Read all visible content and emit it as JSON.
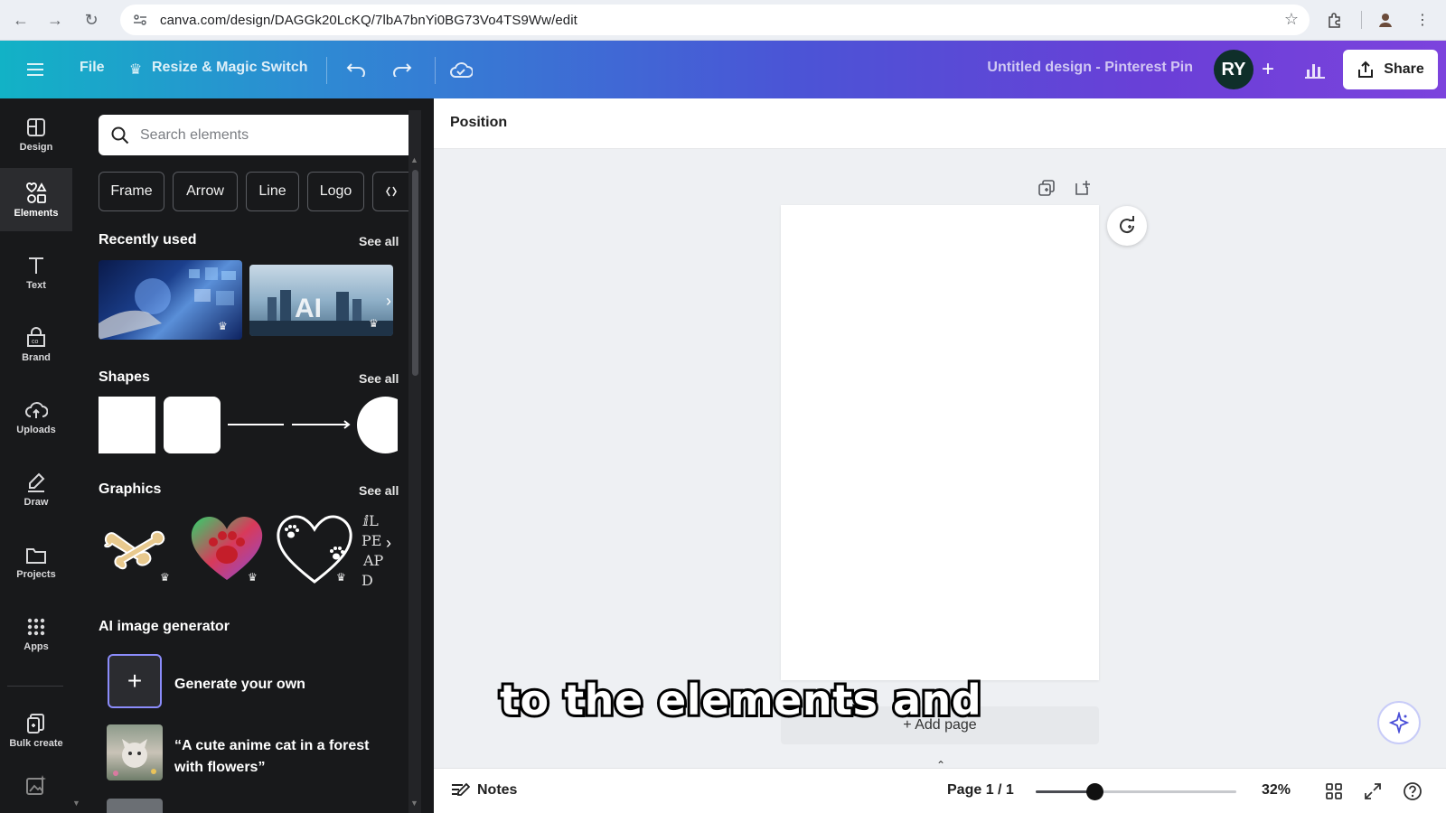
{
  "browser": {
    "url": "canva.com/design/DAGGk20LcKQ/7lbA7bnYi0BG73Vo4TS9Ww/edit"
  },
  "topbar": {
    "file_label": "File",
    "resize_label": "Resize & Magic Switch",
    "doc_title": "Untitled design - Pinterest Pin",
    "avatar_initials": "RY",
    "share_label": "Share",
    "gradient_start": "#12b2c6",
    "gradient_end": "#7c43dd"
  },
  "rail": {
    "items": [
      {
        "label": "Design",
        "icon": "design-icon"
      },
      {
        "label": "Elements",
        "icon": "elements-icon"
      },
      {
        "label": "Text",
        "icon": "text-icon"
      },
      {
        "label": "Brand",
        "icon": "brand-icon"
      },
      {
        "label": "Uploads",
        "icon": "uploads-icon"
      },
      {
        "label": "Draw",
        "icon": "draw-icon"
      },
      {
        "label": "Projects",
        "icon": "projects-icon"
      },
      {
        "label": "Apps",
        "icon": "apps-icon"
      },
      {
        "label": "Bulk create",
        "icon": "bulk-create-icon"
      }
    ],
    "active": "Elements"
  },
  "panel": {
    "search_placeholder": "Search elements",
    "chips": [
      "Frame",
      "Arrow",
      "Line",
      "Logo"
    ],
    "sections": {
      "recently_used": "Recently used",
      "shapes": "Shapes",
      "graphics": "Graphics",
      "ai_generator": "AI image generator"
    },
    "see_all": "See all",
    "generate_label": "Generate your own",
    "prompt_example": "“A cute anime cat in a forest with flowers”"
  },
  "editor": {
    "position_label": "Position",
    "add_page_label": "+ Add page",
    "caption": "to the elements and"
  },
  "bottom": {
    "notes_label": "Notes",
    "page_label": "Page 1 / 1",
    "zoom_label": "32%",
    "zoom_value": 0.32
  }
}
